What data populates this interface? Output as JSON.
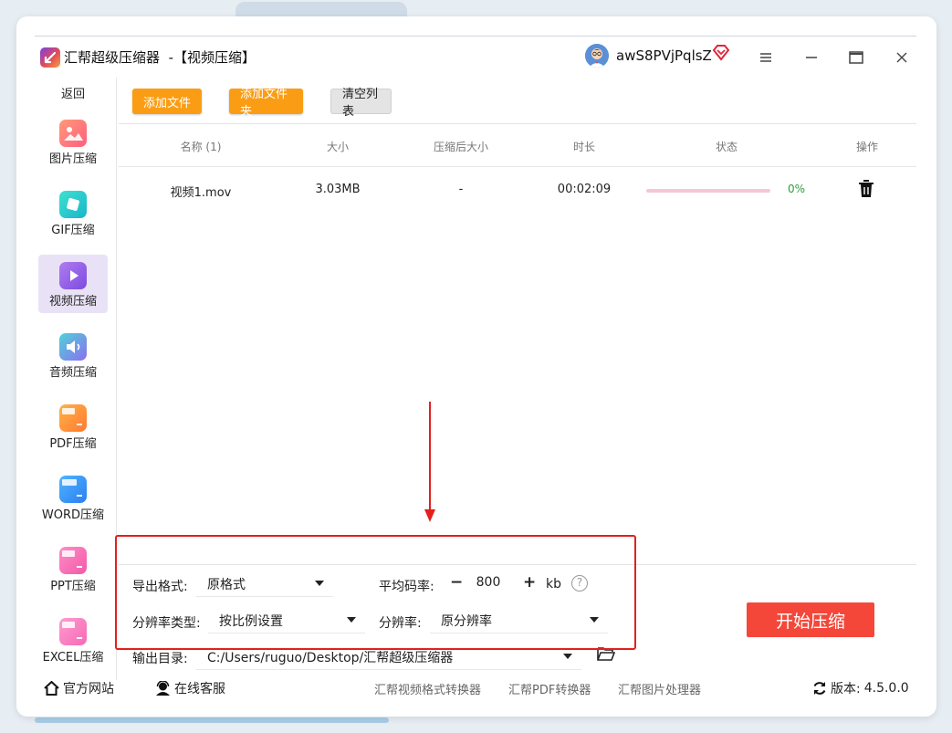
{
  "window": {
    "app_name": "汇帮超级压缩器",
    "title_suffix": "-【视频压缩】",
    "username": "awS8PVjPqlsZ"
  },
  "sidebar": {
    "back_label": "返回",
    "items": [
      {
        "label": "图片压缩",
        "icon": "image-icon",
        "active": false
      },
      {
        "label": "GIF压缩",
        "icon": "gif-icon",
        "active": false
      },
      {
        "label": "视频压缩",
        "icon": "video-play-icon",
        "active": true
      },
      {
        "label": "音频压缩",
        "icon": "audio-icon",
        "active": false
      },
      {
        "label": "PDF压缩",
        "icon": "pdf-file-icon",
        "active": false
      },
      {
        "label": "WORD压缩",
        "icon": "word-file-icon",
        "active": false
      },
      {
        "label": "PPT压缩",
        "icon": "ppt-file-icon",
        "active": false
      },
      {
        "label": "EXCEL压缩",
        "icon": "excel-file-icon",
        "active": false
      }
    ]
  },
  "toolbar": {
    "add_file": "添加文件",
    "add_folder": "添加文件夹",
    "clear_list": "清空列表"
  },
  "table": {
    "headers": {
      "name": "名称 (1)",
      "size": "大小",
      "compressed_size": "压缩后大小",
      "duration": "时长",
      "status": "状态",
      "action": "操作"
    },
    "rows": [
      {
        "name": "视频1.mov",
        "size": "3.03MB",
        "compressed_size": "-",
        "duration": "00:02:09",
        "progress": 0,
        "percent": "0%"
      }
    ]
  },
  "settings": {
    "format_label": "导出格式:",
    "format_value": "原格式",
    "bitrate_label": "平均码率:",
    "bitrate_minus": "−",
    "bitrate_value": "800",
    "bitrate_plus": "+",
    "bitrate_unit": "kb",
    "bitrate_help": "?",
    "res_type_label": "分辨率类型:",
    "res_type_value": "按比例设置",
    "res_label": "分辨率:",
    "res_value": "原分辨率",
    "output_label": "输出目录:",
    "output_value": "C:/Users/ruguo/Desktop/汇帮超级压缩器",
    "start_button": "开始压缩"
  },
  "footer": {
    "website": "官方网站",
    "support": "在线客服",
    "tools": [
      "汇帮视频格式转换器",
      "汇帮PDF转换器",
      "汇帮图片处理器"
    ],
    "version_label": "版本:",
    "version": "4.5.0.0"
  },
  "colors": {
    "accent_orange": "#fb9d14",
    "start_red": "#f4473a",
    "highlight_red": "#e3201d",
    "progress_pink": "#f6c6d8",
    "percent_green": "#2d9c3d",
    "sidebar_active": "#e9e2f6"
  }
}
